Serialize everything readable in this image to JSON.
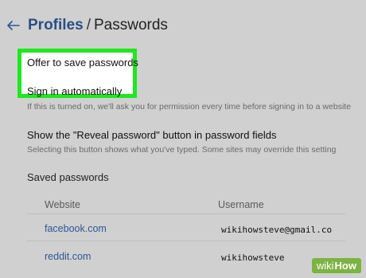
{
  "header": {
    "breadcrumb_parent": "Profiles",
    "breadcrumb_separator": "/",
    "breadcrumb_current": "Passwords"
  },
  "settings": {
    "offer_to_save": "Offer to save passwords",
    "sign_in_auto": "Sign in automatically",
    "sign_in_auto_desc": "If this is turned on, we'll ask you for permission every time before signing in to a website",
    "reveal_button_label": "Show the \"Reveal password\" button in password fields",
    "reveal_button_desc": "Selecting this button shows what you've typed. Some sites may override this setting"
  },
  "saved_passwords": {
    "title": "Saved passwords",
    "columns": {
      "website": "Website",
      "username": "Username"
    },
    "rows": [
      {
        "website": "facebook.com",
        "username": "wikihowsteve@gmail.co"
      },
      {
        "website": "reddit.com",
        "username": "wikihowsteve"
      }
    ]
  },
  "watermark": {
    "prefix": "wiki",
    "suffix": "How"
  },
  "colors": {
    "highlight": "#1ee81e",
    "link": "#2b5797",
    "background": "#d0d0d0"
  }
}
